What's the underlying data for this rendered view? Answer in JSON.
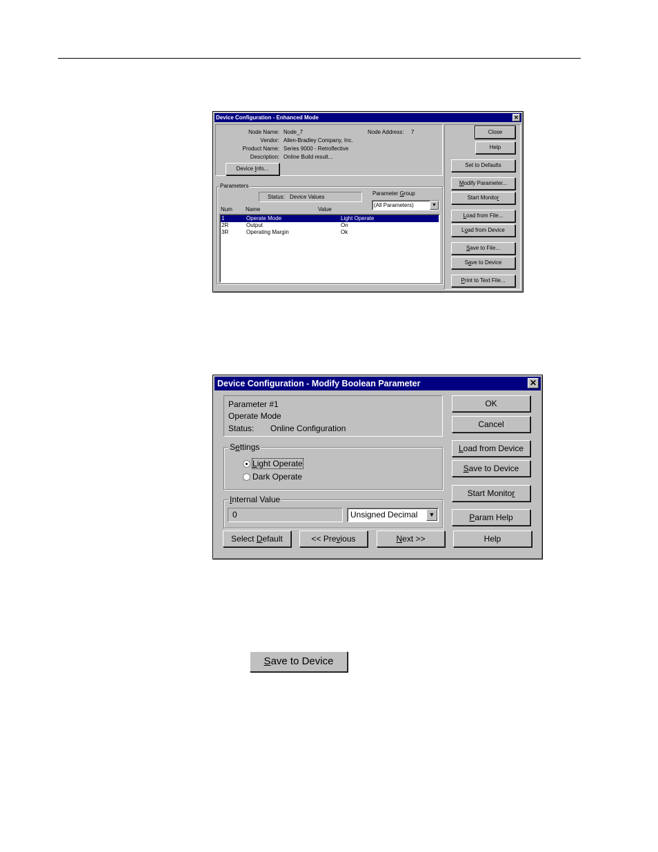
{
  "enhanced": {
    "title": "Device Configuration - Enhanced Mode",
    "close_glyph": "✕",
    "info": {
      "node_name_label": "Node Name:",
      "node_name": "Node_7",
      "vendor_label": "Vendor:",
      "vendor": "Allen-Bradley Company, Inc.",
      "product_label": "Product Name:",
      "product": "Series 9000 - Retroflective",
      "description_label": "Description:",
      "description": "Online Build result...",
      "node_address_label": "Node Address:",
      "node_address": "7",
      "device_info_pre": "Device ",
      "device_info_u": "I",
      "device_info_post": "nfo..."
    },
    "parameters": {
      "legend": "Parameters",
      "status_label": "Status:",
      "status_value": "Device Values",
      "group_label_pre": "Parameter ",
      "group_label_u": "G",
      "group_label_post": "roup",
      "group_value": "(All Parameters)",
      "col_num": "Num",
      "col_name": "Name",
      "col_value": "Value",
      "rows": [
        {
          "num": "1",
          "name": "Operate Mode",
          "value": "Light Operate"
        },
        {
          "num": "2R",
          "name": "Output",
          "value": "On"
        },
        {
          "num": "3R",
          "name": "Operating Margin",
          "value": "Ok"
        }
      ]
    },
    "buttons": {
      "close": "Close",
      "help": "Help",
      "set_defaults": "Set to Defaults",
      "modify_u": "M",
      "modify_post": "odify Parameter...",
      "start_monitor_pre": "Start Monito",
      "start_monitor_u": "r",
      "load_file_u": "L",
      "load_file_post": "oad from File...",
      "load_device_pre": "L",
      "load_device_u": "o",
      "load_device_post": "ad from Device",
      "save_file_u": "S",
      "save_file_post": "ave to File...",
      "save_device_pre": "S",
      "save_device_u": "a",
      "save_device_post": "ve to Device",
      "print_u": "P",
      "print_post": "rint to Text File..."
    }
  },
  "modify": {
    "title": "Device Configuration - Modify Boolean Parameter",
    "close_glyph": "✕",
    "param_number": "Parameter #1",
    "param_name": "Operate Mode",
    "status_label": "Status:",
    "status_value": "Online Configuration",
    "settings_pre": "S",
    "settings_u": "e",
    "settings_post": "ttings",
    "radio_light_u": "L",
    "radio_light_post": "ight Operate",
    "radio_dark": "Dark Operate",
    "internal_u": "I",
    "internal_post": "nternal Value",
    "internal_value": "0",
    "format_value": "Unsigned Decimal",
    "buttons": {
      "ok": "OK",
      "cancel": "Cancel",
      "load_device_u": "L",
      "load_device_post": "oad from Device",
      "save_device_u": "S",
      "save_device_post": "ave to Device",
      "start_monitor_pre": "Start Monito",
      "start_monitor_u": "r",
      "param_help_u": "P",
      "param_help_post": "aram Help",
      "select_default_pre": "Select ",
      "select_default_u": "D",
      "select_default_post": "efault",
      "previous_pre": "<< Pre",
      "previous_u": "v",
      "previous_post": "ious",
      "next_u": "N",
      "next_post": "ext >>",
      "help": "Help"
    }
  },
  "standalone": {
    "save_device_u": "S",
    "save_device_post": "ave to Device"
  }
}
